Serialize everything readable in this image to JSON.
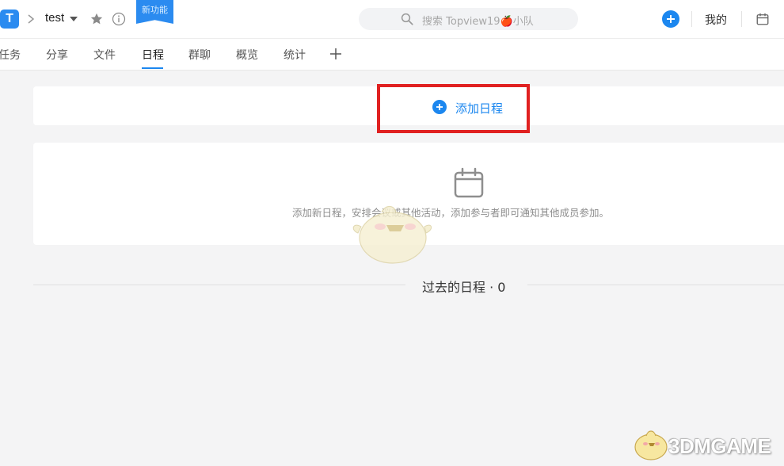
{
  "header": {
    "logo_letter": "T",
    "project_name": "test",
    "new_feature_tag": "新功能",
    "search_placeholder": "搜索 Topview19🍎小队",
    "my_label": "我的"
  },
  "tabs": [
    {
      "label": "任务"
    },
    {
      "label": "分享"
    },
    {
      "label": "文件"
    },
    {
      "label": "日程",
      "active": true
    },
    {
      "label": "群聊"
    },
    {
      "label": "概览"
    },
    {
      "label": "统计"
    }
  ],
  "schedule": {
    "add_label": "添加日程",
    "empty_message": "添加新日程，安排会议或其他活动，添加参与者即可通知其他成员参加。",
    "past_label": "过去的日程 · 0"
  },
  "watermark": {
    "text": "3DMGAME"
  },
  "colors": {
    "accent": "#1c87ef",
    "highlight": "#e02121"
  },
  "icons": {
    "star": "star-icon",
    "info": "info-icon",
    "search": "search-icon",
    "calendar": "calendar-icon"
  }
}
